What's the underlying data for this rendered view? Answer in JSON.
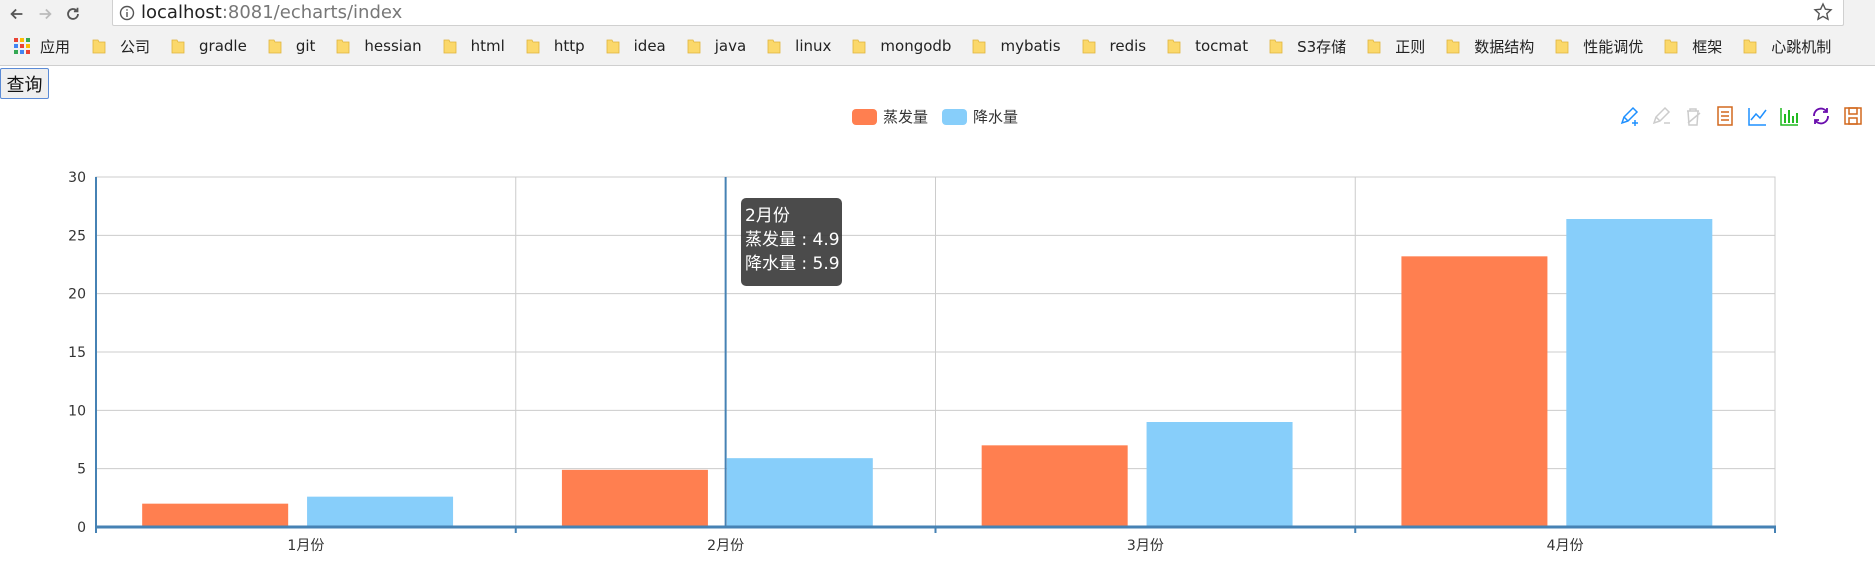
{
  "browser": {
    "url_host": "localhost",
    "url_path": ":8081/echarts/index",
    "bookmarks": [
      "应用",
      "公司",
      "gradle",
      "git",
      "hessian",
      "html",
      "http",
      "idea",
      "java",
      "linux",
      "mongodb",
      "mybatis",
      "redis",
      "tocmat",
      "S3存储",
      "正则",
      "数据结构",
      "性能调优",
      "框架",
      "心跳机制"
    ]
  },
  "page": {
    "query_button_label": "查询"
  },
  "toolbox": {
    "icons": [
      "mark-pen-icon",
      "mark-undo-icon",
      "mark-clear-icon",
      "data-view-icon",
      "line-chart-icon",
      "bar-chart-icon",
      "restore-icon",
      "save-image-icon"
    ]
  },
  "tooltip": {
    "title": "2月份",
    "rows": [
      "蒸发量 : 4.9",
      "降水量 : 5.9"
    ]
  },
  "chart_data": {
    "type": "bar",
    "categories": [
      "1月份",
      "2月份",
      "3月份",
      "4月份"
    ],
    "series": [
      {
        "name": "蒸发量",
        "color": "#ff7f50",
        "values": [
          2.0,
          4.9,
          7.0,
          23.2
        ]
      },
      {
        "name": "降水量",
        "color": "#87cefa",
        "values": [
          2.6,
          5.9,
          9.0,
          26.4
        ]
      }
    ],
    "ylim": [
      0,
      30
    ],
    "yticks": [
      0,
      5,
      10,
      15,
      20,
      25,
      30
    ],
    "grid": true,
    "legend_position": "top-center",
    "axis_color": "#4682b4"
  }
}
